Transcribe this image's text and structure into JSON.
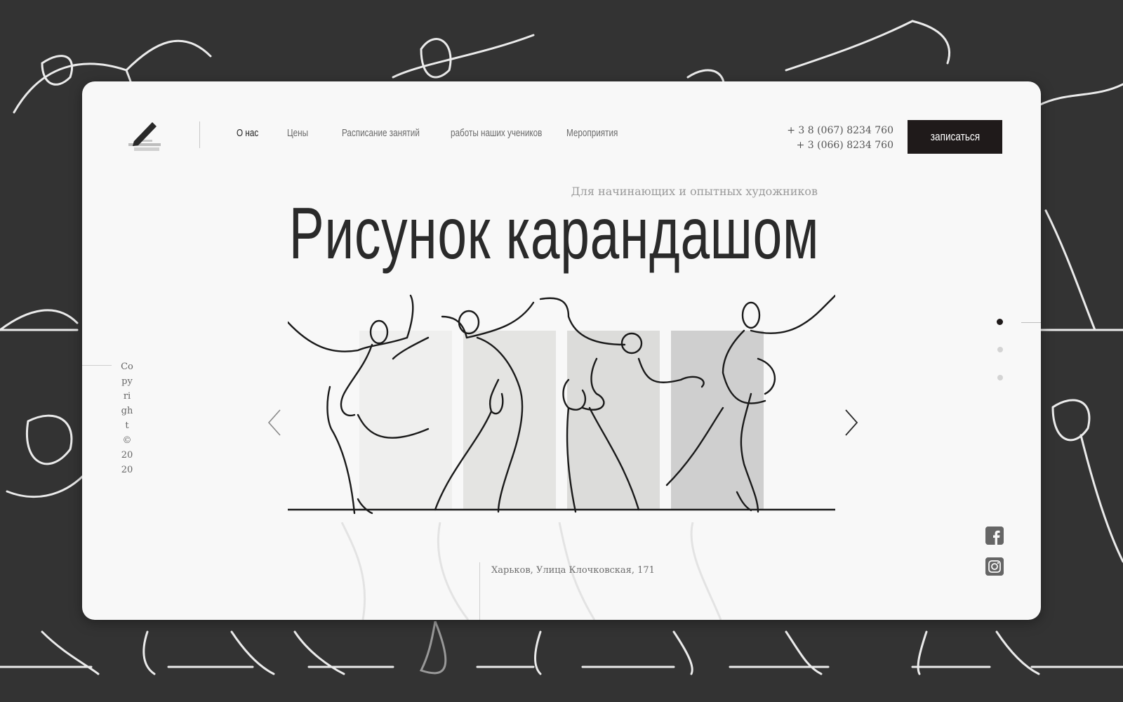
{
  "header": {
    "logo_icon": "pencil-logo-icon",
    "nav": [
      {
        "label": "О нас",
        "active": true
      },
      {
        "label": "Цены",
        "active": false
      },
      {
        "label": "Расписание занятий",
        "active": false
      },
      {
        "label": "работы наших учеников",
        "active": false
      },
      {
        "label": "Мероприятия",
        "active": false
      }
    ],
    "phones": [
      "+ 3 8 (067) 8234 760",
      "+ 3 (066) 8234 760"
    ],
    "signup_label": "записаться"
  },
  "hero": {
    "subtitle": "Для начинающих и опытных художников",
    "title": "Рисунок карандашом"
  },
  "slider": {
    "prev_icon": "chevron-left-icon",
    "next_icon": "chevron-right-icon",
    "active_slide": 1,
    "slide_count": 3
  },
  "footer": {
    "address": "Харьков, Улица Клочковская, 171",
    "copyright": "Copyright© 2020"
  },
  "social": [
    "facebook-icon",
    "instagram-icon"
  ],
  "colors": {
    "background": "#333333",
    "card": "#f8f8f8",
    "accent": "#1f1a1a",
    "panel_1": "#efefee",
    "panel_2": "#e4e4e2",
    "panel_3": "#dcdcda",
    "panel_4": "#cfcfcf"
  }
}
